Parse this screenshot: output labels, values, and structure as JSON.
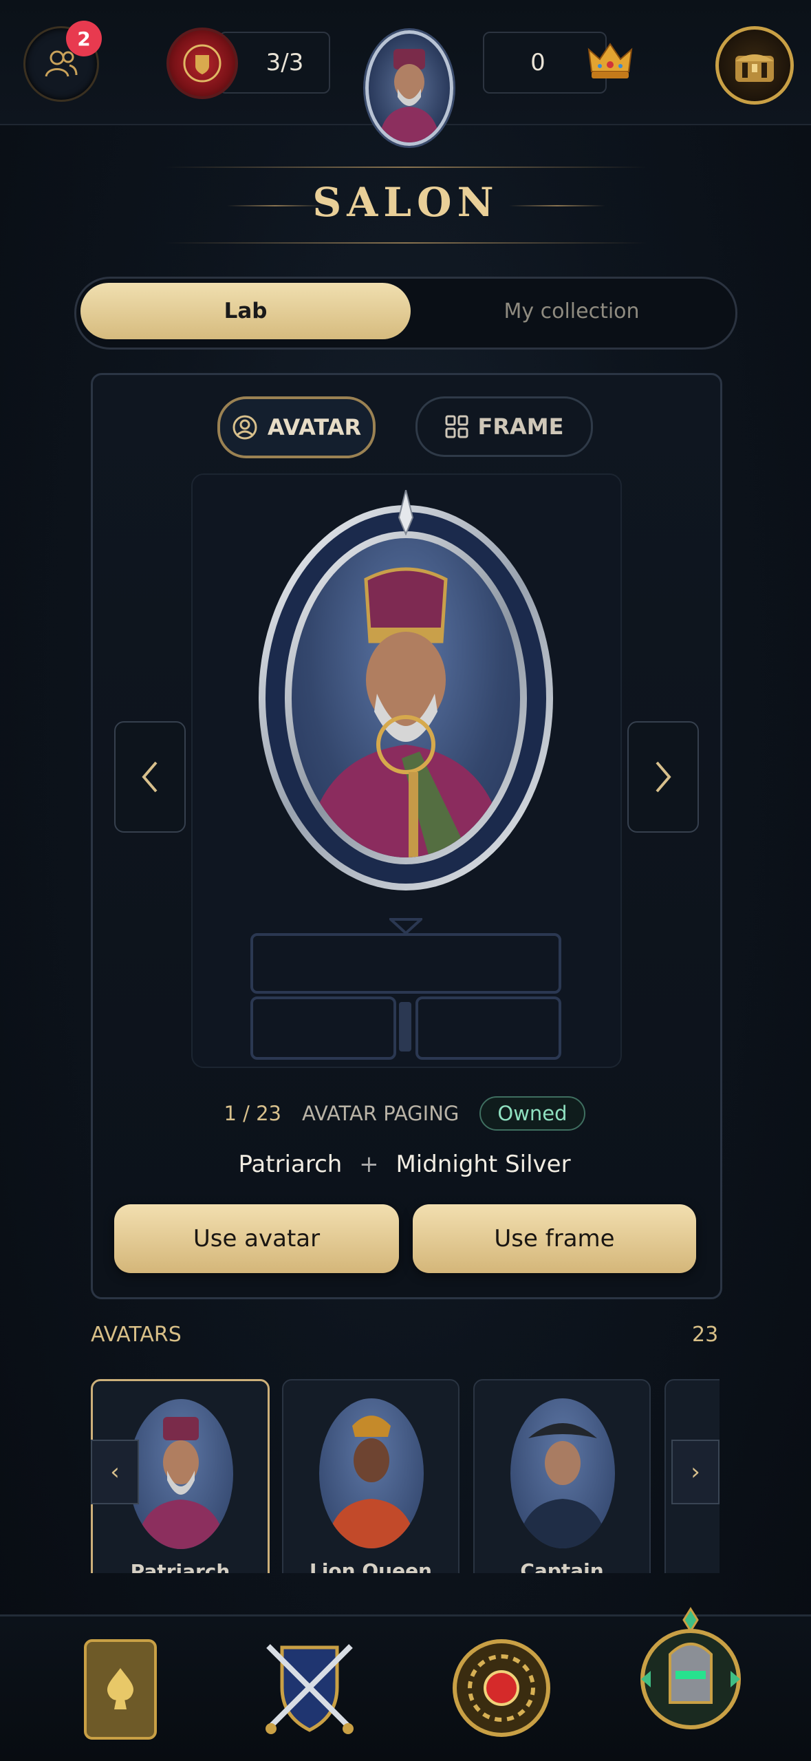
{
  "top_bar": {
    "friends_badge": "2",
    "tickets": "3/3",
    "crowns": "0"
  },
  "title": "SALON",
  "tabs": [
    "Lab",
    "My collection"
  ],
  "segments": {
    "avatar": "AVATAR",
    "frame": "FRAME"
  },
  "paging": {
    "position": "1 / 23",
    "label": "AVATAR PAGING",
    "status": "Owned"
  },
  "combo": {
    "avatar_name": "Patriarch",
    "plus": "+",
    "frame_name": "Midnight Silver"
  },
  "actions": {
    "use_avatar": "Use avatar",
    "use_frame": "Use frame"
  },
  "avatars_section": {
    "label": "AVATARS",
    "count": "23",
    "items": [
      {
        "name": "Patriarch"
      },
      {
        "name": "Lion Queen"
      },
      {
        "name": "Captain"
      }
    ]
  },
  "icons": {
    "friends": "friends-icon",
    "medal": "medal-icon",
    "crown": "crown-icon",
    "chest": "chest-icon",
    "cards": "spade-card-icon",
    "battle": "crossed-swords-icon",
    "wheel": "wheel-icon",
    "knight": "knight-helmet-icon"
  },
  "colors": {
    "accent_gold": "#d6bb7e",
    "badge_red": "#e83a4f",
    "owned_green": "#8fe0c0"
  }
}
